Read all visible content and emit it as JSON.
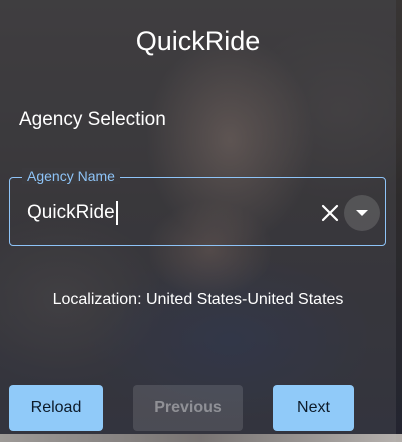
{
  "app": {
    "title": "QuickRide"
  },
  "agency_selection": {
    "heading": "Agency Selection",
    "field_label": "Agency Name",
    "field_value": "QuickRide",
    "clear_icon": "close-icon",
    "dropdown_icon": "caret-down-icon"
  },
  "localization": {
    "text": "Localization: United States-United States"
  },
  "actions": {
    "reload_label": "Reload",
    "previous_label": "Previous",
    "next_label": "Next"
  },
  "colors": {
    "accent": "#90caf9",
    "disabled_text": "rgba(255,255,255,0.38)"
  }
}
